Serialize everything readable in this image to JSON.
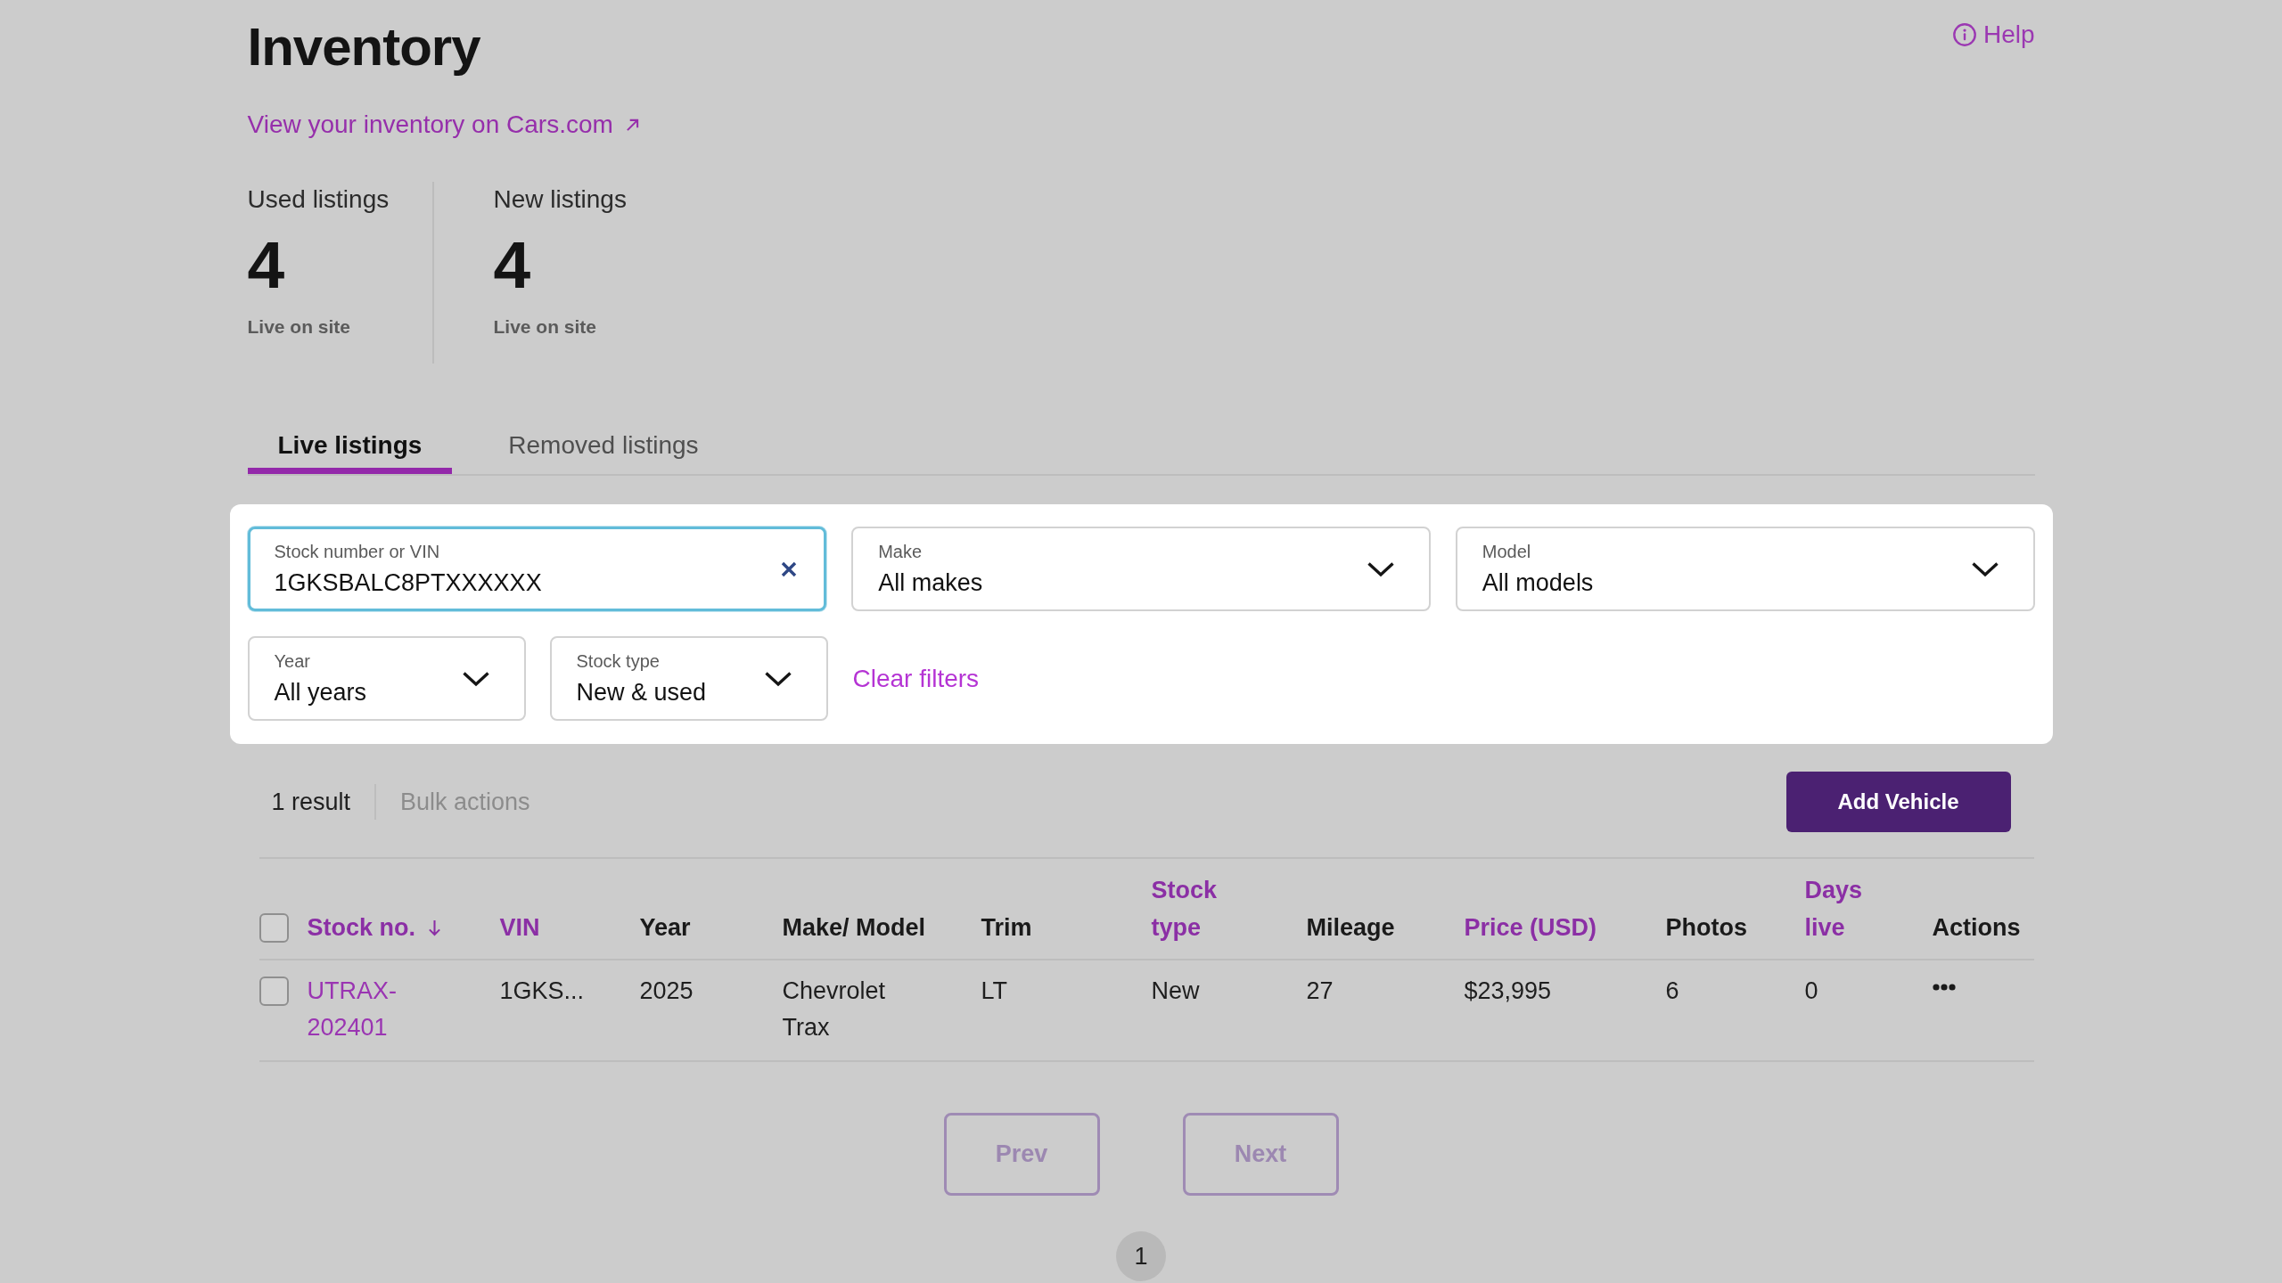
{
  "header": {
    "title": "Inventory",
    "help": "Help",
    "site_link": "View your inventory on Cars.com"
  },
  "stats": [
    {
      "label": "Used listings",
      "value": "4",
      "caption": "Live on site"
    },
    {
      "label": "New listings",
      "value": "4",
      "caption": "Live on site"
    }
  ],
  "tabs": [
    {
      "label": "Live listings",
      "selected": true
    },
    {
      "label": "Removed listings",
      "selected": false
    }
  ],
  "filters": {
    "rows": [
      [
        {
          "kind": "search",
          "label": "Stock number or VIN",
          "value": "1GKSBALC8PTXXXXXX",
          "focused": true
        },
        {
          "kind": "select",
          "label": "Make",
          "value": "All makes",
          "focused": false
        },
        {
          "kind": "select",
          "label": "Model",
          "value": "All models",
          "focused": false
        }
      ],
      [
        {
          "kind": "select",
          "label": "Year",
          "value": "All years",
          "focused": false
        },
        {
          "kind": "select",
          "label": "Stock type",
          "value": "New & used",
          "focused": false
        }
      ]
    ],
    "clear_filters": "Clear filters"
  },
  "results": {
    "count": "1 result",
    "bulk_actions": {
      "label": "Bulk actions",
      "disabled": true
    },
    "add_button": "Add Vehicle"
  },
  "table": {
    "select_all": {
      "checked": false
    },
    "columns": [
      {
        "label": "Stock no.",
        "sortable": true,
        "sorted": true
      },
      {
        "label": "VIN",
        "sortable": true,
        "sorted": false
      },
      {
        "label": "Year",
        "sortable": false,
        "sorted": false
      },
      {
        "label": "Make/ Model",
        "sortable": false,
        "sorted": false
      },
      {
        "label": "Trim",
        "sortable": false,
        "sorted": false
      },
      {
        "label": "Stock type",
        "sortable": true,
        "sorted": false
      },
      {
        "label": "Mileage",
        "sortable": false,
        "sorted": false
      },
      {
        "label": "Price (USD)",
        "sortable": true,
        "sorted": false
      },
      {
        "label": "Photos",
        "sortable": false,
        "sorted": false
      },
      {
        "label": "Days live",
        "sortable": true,
        "sorted": false
      },
      {
        "label": "Actions",
        "sortable": false,
        "sorted": false
      }
    ],
    "rows": [
      {
        "selected": false,
        "cells": [
          {
            "kind": "link",
            "text": "UTRAX-202401"
          },
          {
            "kind": "text",
            "text": "1GKS..."
          },
          {
            "kind": "text",
            "text": "2025"
          },
          {
            "kind": "text",
            "text": "Chevrolet Trax"
          },
          {
            "kind": "text",
            "text": "LT"
          },
          {
            "kind": "text",
            "text": "New"
          },
          {
            "kind": "text",
            "text": "27"
          },
          {
            "kind": "text",
            "text": "$23,995"
          },
          {
            "kind": "text",
            "text": "6"
          },
          {
            "kind": "text",
            "text": "0"
          },
          {
            "kind": "menu"
          }
        ]
      }
    ]
  },
  "pagination": {
    "prev": {
      "label": "Prev",
      "disabled": true
    },
    "next": {
      "label": "Next",
      "disabled": true
    },
    "pages": [
      {
        "label": "1",
        "selected": true
      }
    ]
  }
}
